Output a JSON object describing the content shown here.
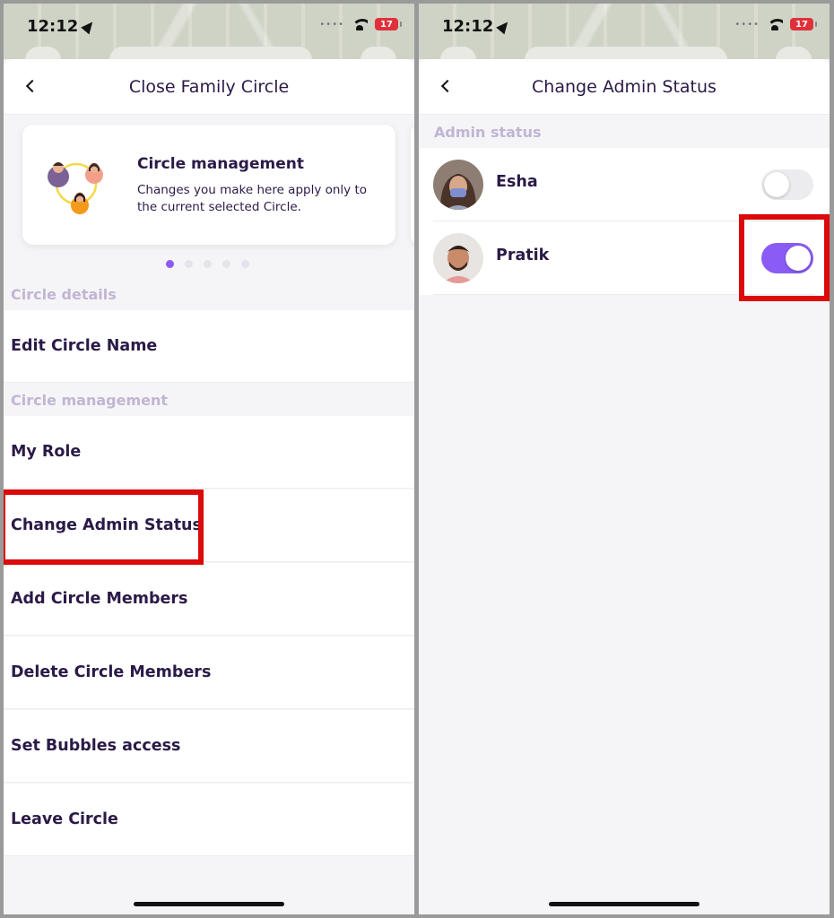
{
  "left_screen": {
    "status_bar": {
      "time": "12:12",
      "battery": "17"
    },
    "header": {
      "title": "Close Family Circle"
    },
    "info_card": {
      "title": "Circle management",
      "description": "Changes you make here apply only to the current selected Circle.",
      "page_count": 5,
      "active_page": 1
    },
    "sections": [
      {
        "title": "Circle details",
        "items": [
          "Edit Circle Name"
        ]
      },
      {
        "title": "Circle management",
        "items": [
          "My Role",
          "Change Admin Status",
          "Add Circle Members",
          "Delete Circle Members",
          "Set Bubbles access",
          "Leave Circle"
        ]
      }
    ]
  },
  "right_screen": {
    "status_bar": {
      "time": "12:12",
      "battery": "17"
    },
    "header": {
      "title": "Change Admin Status"
    },
    "section_title": "Admin status",
    "members": [
      {
        "name": "Esha",
        "admin": false
      },
      {
        "name": "Pratik",
        "admin": true
      }
    ]
  },
  "colors": {
    "accent": "#8a5cf5",
    "text_primary": "#2b1a47",
    "section_header": "#c1b5d3",
    "highlight": "#dc0a0a",
    "background": "#f5f5f7"
  }
}
